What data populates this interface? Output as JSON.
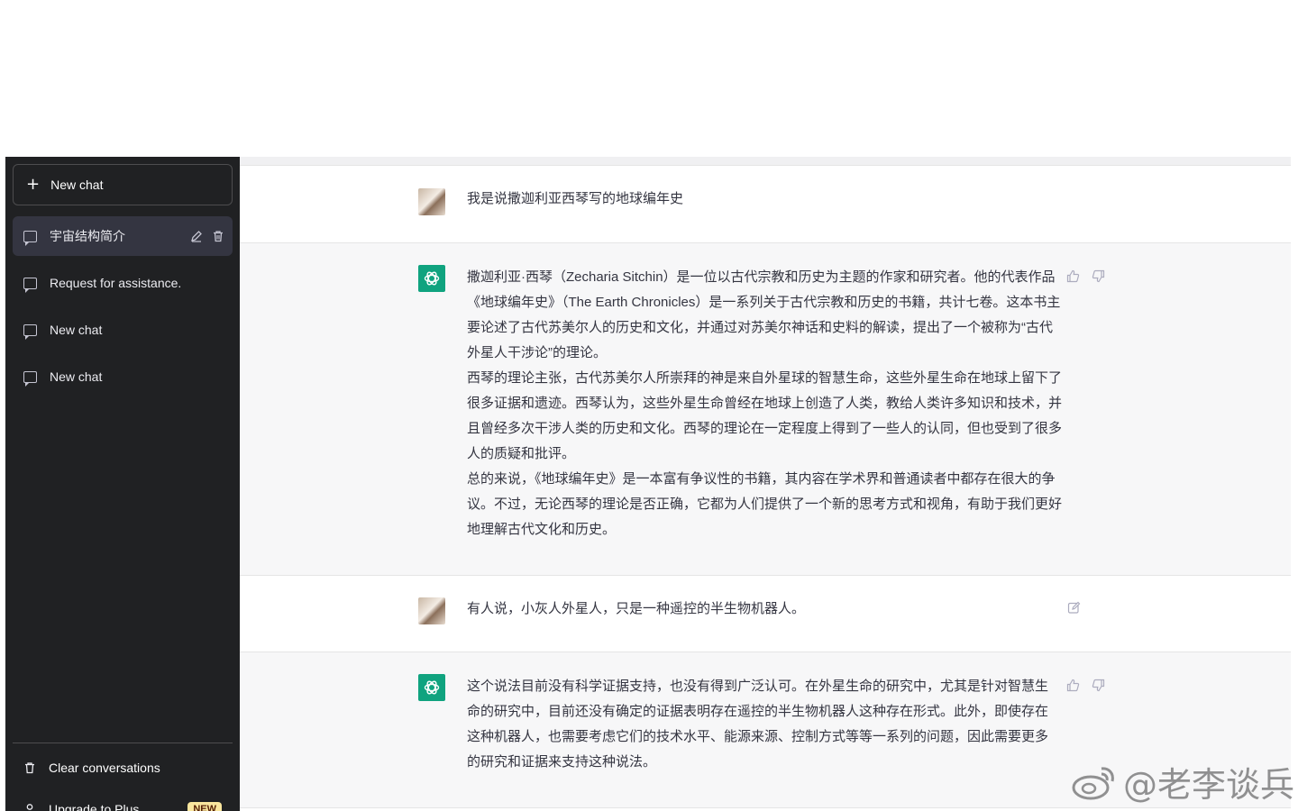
{
  "sidebar": {
    "new_chat_label": "New chat",
    "conversations": [
      {
        "label": "宇宙结构简介",
        "active": true
      },
      {
        "label": "Request for assistance."
      },
      {
        "label": "New chat"
      },
      {
        "label": "New chat"
      }
    ],
    "clear_label": "Clear conversations",
    "upgrade_label": "Upgrade to Plus",
    "upgrade_badge": "NEW"
  },
  "messages": [
    {
      "role": "user",
      "text": "我是说撒迦利亚西琴写的地球编年史"
    },
    {
      "role": "assistant",
      "paragraphs": [
        "撒迦利亚·西琴（Zecharia Sitchin）是一位以古代宗教和历史为主题的作家和研究者。他的代表作品《地球编年史》（The Earth Chronicles）是一系列关于古代宗教和历史的书籍，共计七卷。这本书主要论述了古代苏美尔人的历史和文化，并通过对苏美尔神话和史料的解读，提出了一个被称为“古代外星人干涉论”的理论。",
        "西琴的理论主张，古代苏美尔人所崇拜的神是来自外星球的智慧生命，这些外星生命在地球上留下了很多证据和遗迹。西琴认为，这些外星生命曾经在地球上创造了人类，教给人类许多知识和技术，并且曾经多次干涉人类的历史和文化。西琴的理论在一定程度上得到了一些人的认同，但也受到了很多人的质疑和批评。",
        "总的来说，《地球编年史》是一本富有争议性的书籍，其内容在学术界和普通读者中都存在很大的争议。不过，无论西琴的理论是否正确，它都为人们提供了一个新的思考方式和视角，有助于我们更好地理解古代文化和历史。"
      ]
    },
    {
      "role": "user",
      "text": "有人说，小灰人外星人，只是一种遥控的半生物机器人。"
    },
    {
      "role": "assistant",
      "paragraphs": [
        "这个说法目前没有科学证据支持，也没有得到广泛认可。在外星生命的研究中，尤其是针对智慧生命的研究中，目前还没有确定的证据表明存在遥控的半生物机器人这种存在形式。此外，即使存在这种机器人，也需要考虑它们的技术水平、能源来源、控制方式等等一系列的问题，因此需要更多的研究和证据来支持这种说法。"
      ]
    }
  ],
  "watermark": "@老李谈兵",
  "colors": {
    "sidebar_bg": "#202123",
    "assistant_bg": "#f7f7f8",
    "brand_green": "#10a37f",
    "text": "#343541"
  }
}
